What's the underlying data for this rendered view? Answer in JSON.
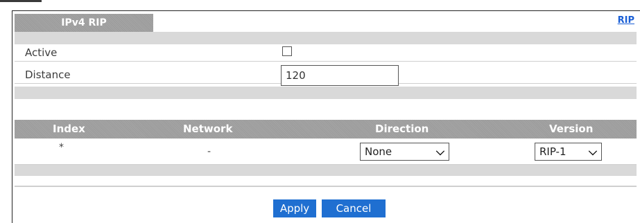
{
  "header": {
    "tab_label": "IPv4 RIP",
    "link_label": "RIP"
  },
  "settings": {
    "active_label": "Active",
    "active_checked": false,
    "distance_label": "Distance",
    "distance_value": "120"
  },
  "table": {
    "columns": [
      "Index",
      "Network",
      "Direction",
      "Version"
    ],
    "row": {
      "index": "*",
      "network": "-",
      "direction": "None",
      "version": "RIP-1"
    }
  },
  "actions": {
    "apply_label": "Apply",
    "cancel_label": "Cancel"
  },
  "colors": {
    "button": "#1f6fd1",
    "link": "#1a5fd6",
    "header_bar": "#a0a0a0"
  }
}
